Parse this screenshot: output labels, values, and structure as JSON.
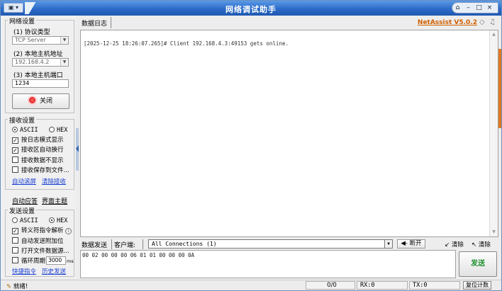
{
  "window": {
    "title": "网络调试助手",
    "sysmenu_label": "▣ ▾",
    "caption_buttons": {
      "pin": "⌂",
      "minimize": "–",
      "restore": "□",
      "close": "×"
    }
  },
  "network_settings": {
    "group_label": "网络设置",
    "protocol_label": "(1) 协议类型",
    "protocol_value": "TCP Server",
    "host_label": "(2) 本地主机地址",
    "host_value": "192.168.4.2",
    "port_label": "(3) 本地主机端口",
    "port_value": "1234",
    "close_button_label": "关闭"
  },
  "receive_settings": {
    "group_label": "接收设置",
    "format_ascii": "ASCII",
    "format_hex": "HEX",
    "selected_format": "ASCII",
    "options": [
      {
        "label": "按日志模式显示",
        "checked": true
      },
      {
        "label": "接收区自动换行",
        "checked": true
      },
      {
        "label": "接收数据不显示",
        "checked": false
      },
      {
        "label": "接收保存到文件...",
        "checked": false
      }
    ],
    "link_autoscroll": "自动滚屏",
    "link_clear": "清除接收"
  },
  "lower_tabs": {
    "auto_reply": "自动应答",
    "theme": "界面主题"
  },
  "send_settings": {
    "group_label": "发送设置",
    "format_ascii": "ASCII",
    "format_hex": "HEX",
    "selected_format": "HEX",
    "options": [
      {
        "label": "转义符指令解析",
        "checked": true
      },
      {
        "label": "自动发送附加位",
        "checked": false
      },
      {
        "label": "打开文件数据源...",
        "checked": false
      }
    ],
    "loop_label": "循环周期",
    "loop_value": "3000",
    "loop_unit": "ms",
    "link_shortcuts": "快捷指令",
    "link_history": "历史发送"
  },
  "data_log": {
    "tab_label": "数据日志",
    "brand": "NetAssist V5.0.2",
    "log_line": "[2025-12-25 18:26:07.265]# Client 192.168.4.3:49153 gets online."
  },
  "send_bar": {
    "send_tab": "数据发送",
    "client_label": "客户端:",
    "connection_value": "All Connections (1)",
    "disconnect_label": "断开",
    "clear_send": "清除",
    "clear_recv": "清除",
    "send_text": "00 02 00 00 00 06 01 01 00 00 00 0A",
    "send_button": "发送"
  },
  "status_bar": {
    "ready": "就绪!",
    "counter": "0/0",
    "rx": "RX:0",
    "tx": "TX:0",
    "reset": "复位计数"
  }
}
